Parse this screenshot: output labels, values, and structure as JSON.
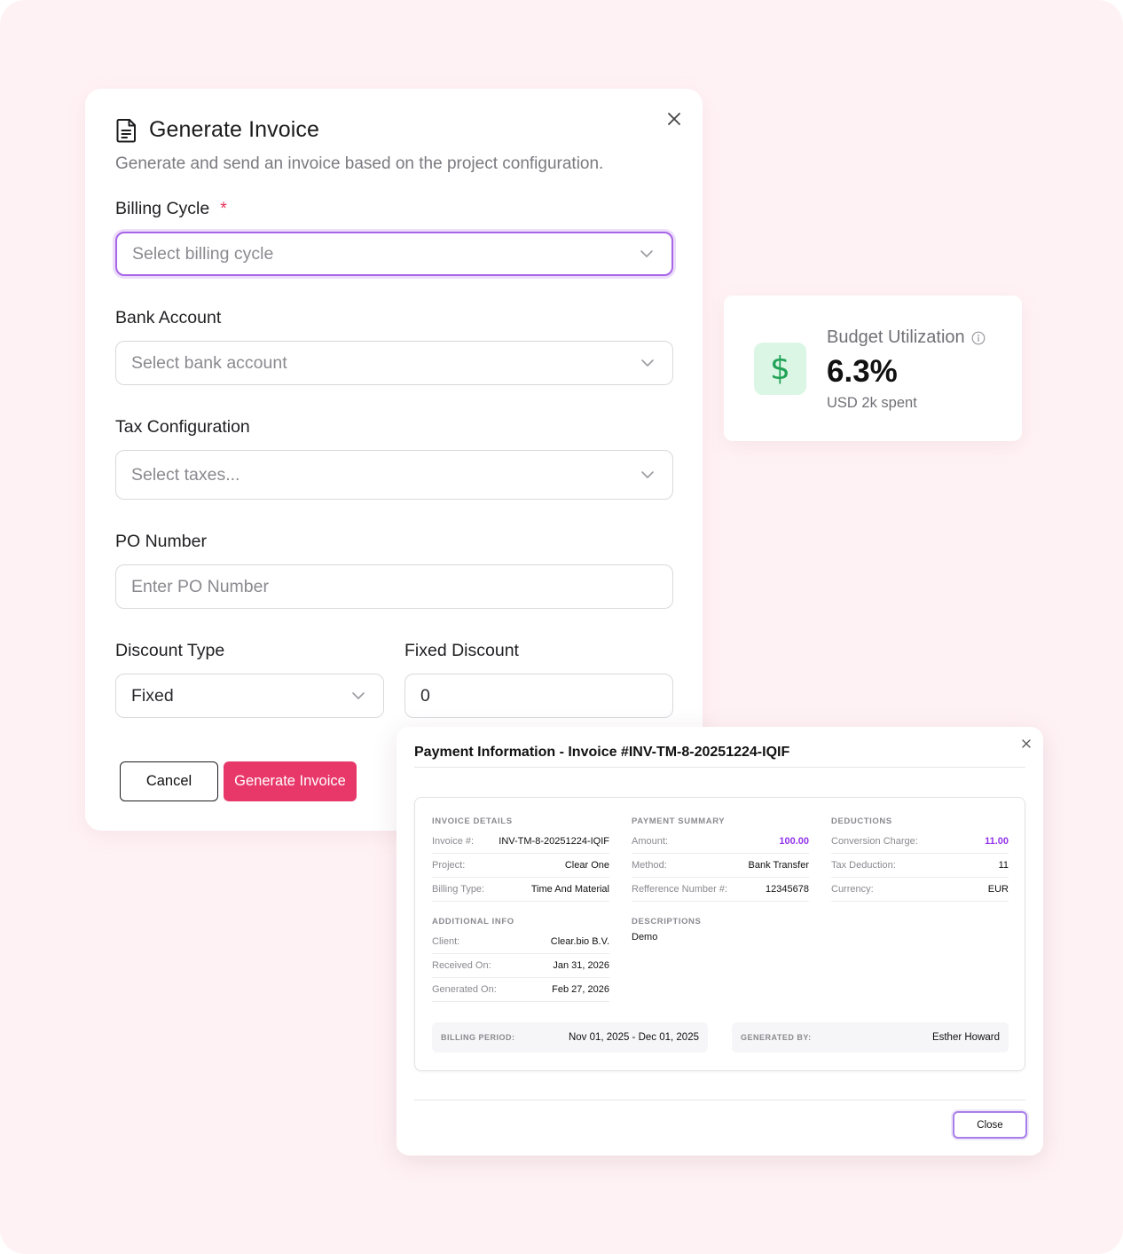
{
  "generate_invoice": {
    "title": "Generate Invoice",
    "subtitle": "Generate and send an invoice based on the project configuration.",
    "billing_cycle": {
      "label": "Billing Cycle",
      "required_mark": "*",
      "placeholder": "Select billing cycle"
    },
    "bank_account": {
      "label": "Bank Account",
      "placeholder": "Select bank account"
    },
    "tax_configuration": {
      "label": "Tax Configuration",
      "placeholder": "Select taxes..."
    },
    "po_number": {
      "label": "PO Number",
      "placeholder": "Enter PO Number",
      "value": ""
    },
    "discount_type": {
      "label": "Discount Type",
      "value": "Fixed"
    },
    "fixed_discount": {
      "label": "Fixed Discount",
      "value": "0"
    },
    "cancel_label": "Cancel",
    "generate_label": "Generate Invoice",
    "colors": {
      "focus": "#a865e8",
      "primary_button": "#e8386a",
      "required": "#e5345e"
    }
  },
  "budget": {
    "label": "Budget Utilization",
    "value": "6.3%",
    "sub": "USD 2k spent",
    "icon": "dollar-icon",
    "colors": {
      "icon_bg": "#dbf6e5",
      "icon_fg": "#21a356"
    }
  },
  "payment": {
    "title": "Payment Information - Invoice #INV-TM-8-20251224-IQIF",
    "invoice_details": {
      "title": "INVOICE DETAILS",
      "rows": [
        {
          "k": "Invoice #:",
          "v": "INV-TM-8-20251224-IQIF"
        },
        {
          "k": "Project:",
          "v": "Clear One"
        },
        {
          "k": "Billing Type:",
          "v": "Time And Material"
        }
      ]
    },
    "payment_summary": {
      "title": "PAYMENT SUMMARY",
      "rows": [
        {
          "k": "Amount:",
          "v": "100.00"
        },
        {
          "k": "Method:",
          "v": "Bank Transfer"
        },
        {
          "k": "Refference Number #:",
          "v": "12345678"
        }
      ]
    },
    "deductions": {
      "title": "DEDUCTIONS",
      "rows": [
        {
          "k": "Conversion Charge:",
          "v": "11.00"
        },
        {
          "k": "Tax Deduction:",
          "v": "11"
        },
        {
          "k": "Currency:",
          "v": "EUR"
        }
      ]
    },
    "additional_info": {
      "title": "ADDITIONAL INFO",
      "rows": [
        {
          "k": "Client:",
          "v": "Clear.bio B.V."
        },
        {
          "k": "Received On:",
          "v": "Jan 31, 2026"
        },
        {
          "k": "Generated On:",
          "v": "Feb 27, 2026"
        }
      ]
    },
    "descriptions": {
      "title": "DESCRIPTIONS",
      "value": "Demo"
    },
    "billing_period": {
      "k": "BILLING PERIOD:",
      "v": "Nov 01, 2025 - Dec 01, 2025"
    },
    "generated_by": {
      "k": "GENERATED BY:",
      "v": "Esther Howard"
    },
    "close_label": "Close",
    "colors": {
      "accent": "#9333ea"
    }
  }
}
